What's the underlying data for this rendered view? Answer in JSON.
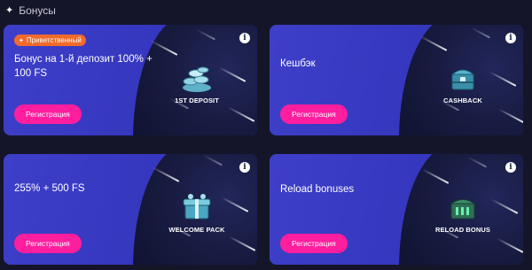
{
  "header": {
    "title": "Бонусы"
  },
  "cards": [
    {
      "badge": "Приветственный",
      "title": "Бонус на 1-й депозит 100% + 100 FS",
      "button": "Регистрация",
      "item_label": "1ST DEPOSIT",
      "item_icon": "coins-icon"
    },
    {
      "badge": "",
      "title": "Кешбэк",
      "button": "Регистрация",
      "item_label": "CASHBACK",
      "item_icon": "chest-icon"
    },
    {
      "badge": "",
      "title": "255% + 500 FS",
      "button": "Регистрация",
      "item_label": "WELCOME PACK",
      "item_icon": "welcome-box-icon"
    },
    {
      "badge": "",
      "title": "Reload bonuses",
      "button": "Регистрация",
      "item_label": "RELOAD BONUS",
      "item_icon": "reload-chest-icon"
    }
  ],
  "colors": {
    "page_bg": "#15152a",
    "card_bg": "#3436bd",
    "button": "#ff1e9e",
    "badge": "#f06a2a"
  }
}
